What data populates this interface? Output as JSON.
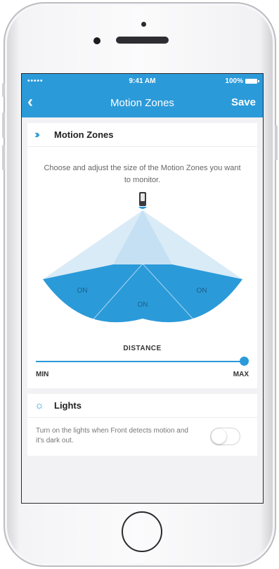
{
  "status_bar": {
    "signal": "•••••",
    "time": "9:41 AM",
    "battery": "100%"
  },
  "nav": {
    "back_icon": "chevron-left-icon",
    "title": "Motion Zones",
    "save_label": "Save"
  },
  "motion_card": {
    "icon": "triple-chevron-icon",
    "title": "Motion Zones",
    "description": "Choose and adjust the size of the Motion Zones you want to monitor.",
    "zones": [
      {
        "label": "ON",
        "state": "on"
      },
      {
        "label": "ON",
        "state": "on"
      },
      {
        "label": "ON",
        "state": "on"
      }
    ],
    "distance_label": "DISTANCE",
    "distance_value": 1.0,
    "min_label": "MIN",
    "max_label": "MAX"
  },
  "lights_card": {
    "icon": "lightbulb-icon",
    "title": "Lights",
    "description": "Turn on the lights when Front detects motion and it's dark out.",
    "toggle_on": false
  },
  "colors": {
    "accent": "#2b9ad9",
    "zone_light": "#d9ebf7",
    "zone_mid": "#c4e0f2"
  }
}
